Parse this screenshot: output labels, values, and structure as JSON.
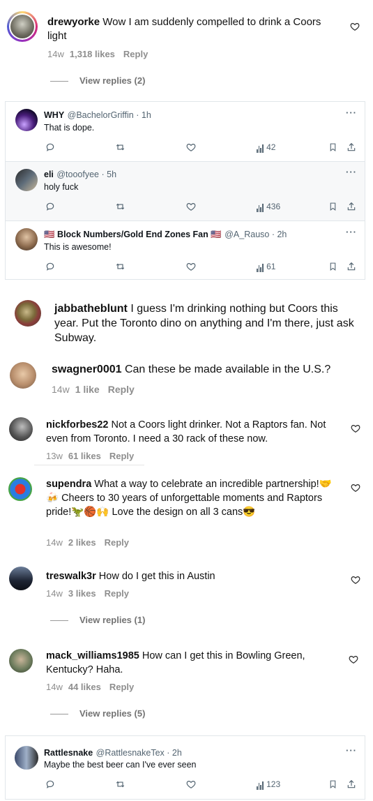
{
  "ig_comments": [
    {
      "username": "drewyorke",
      "text": "Wow I am suddenly compelled to drink a Coors light",
      "age": "14w",
      "likes": "1,318 likes",
      "reply": "Reply",
      "view_replies": "View replies (2)"
    },
    {
      "username": "jabbatheblunt",
      "text": "I guess I'm drinking nothing but Coors this year. Put the Toronto dino on anything and I'm there, just ask Subway."
    },
    {
      "username": "swagner0001",
      "text": "Can these be made available in the U.S.?",
      "age": "14w",
      "likes": "1 like",
      "reply": "Reply"
    },
    {
      "username": "nickforbes22",
      "text": "Not a Coors light drinker. Not a Raptors fan. Not even from Toronto. I need a 30 rack of these now.",
      "age": "13w",
      "likes": "61 likes",
      "reply": "Reply"
    },
    {
      "username": "supendra",
      "text": "What a way to celebrate an incredible partnership!🤝🍻 Cheers to 30 years of unforgettable moments and Raptors pride!🦖🏀🙌 Love the design on all 3 cans😎",
      "age": "14w",
      "likes": "2 likes",
      "reply": "Reply"
    },
    {
      "username": "treswalk3r",
      "text": "How do I get this in Austin",
      "age": "14w",
      "likes": "3 likes",
      "reply": "Reply",
      "view_replies": "View replies (1)"
    },
    {
      "username": "mack_williams1985",
      "text": "How can I get this in Bowling Green, Kentucky? Haha.",
      "age": "14w",
      "likes": "44 likes",
      "reply": "Reply",
      "view_replies": "View replies (5)"
    }
  ],
  "x_posts": [
    {
      "name": "WHY",
      "handle": "@BachelorGriffin · 1h",
      "text": "That is dope.",
      "views": "42"
    },
    {
      "name": "eli",
      "handle": "@tooofyee · 5h",
      "text": "holy fuck",
      "views": "436"
    },
    {
      "name": "🇺🇸 Block Numbers/Gold End Zones Fan 🇺🇸",
      "handle": "@A_Rauso · 2h",
      "text": "This is awesome!",
      "views": "61"
    },
    {
      "name": "Rattlesnake",
      "handle": "@RattlesnakeTex · 2h",
      "text": "Maybe the best beer can I've ever seen",
      "views": "123"
    }
  ],
  "icons": {
    "more": "···",
    "reply": "comment-icon",
    "retweet": "retweet-icon",
    "like": "heart-icon",
    "views": "views-icon",
    "bookmark": "bookmark-icon",
    "share": "share-icon"
  }
}
